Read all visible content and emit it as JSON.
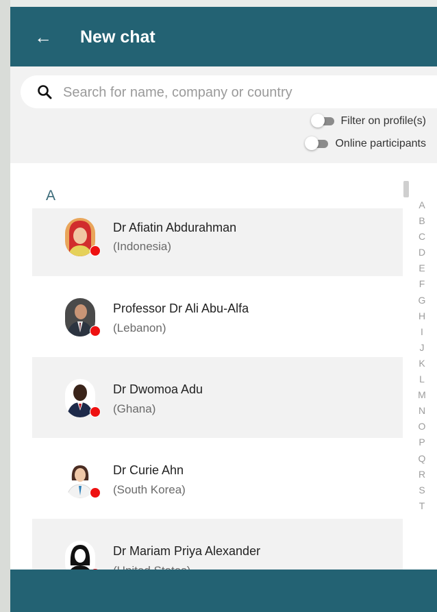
{
  "header": {
    "title": "New chat",
    "back_icon": "arrow-left-icon"
  },
  "search": {
    "placeholder": "Search for name, company or country",
    "value": "",
    "icon": "search-icon"
  },
  "filters": [
    {
      "label": "Filter on profile(s)",
      "on": false
    },
    {
      "label": "Online participants",
      "on": false
    }
  ],
  "list": {
    "section_letter": "A",
    "participants": [
      {
        "name": "Dr Afiatin Abdurahman",
        "country": "(Indonesia)",
        "status_color": "#ee1111"
      },
      {
        "name": "Professor Dr Ali Abu-Alfa",
        "country": "(Lebanon)",
        "status_color": "#ee1111"
      },
      {
        "name": "Dr Dwomoa Adu",
        "country": "(Ghana)",
        "status_color": "#ee1111"
      },
      {
        "name": "Dr Curie Ahn",
        "country": "(South Korea)",
        "status_color": "#ee1111"
      },
      {
        "name": "Dr Mariam Priya Alexander",
        "country": "(United States)",
        "status_color": "#ee1111"
      }
    ]
  },
  "alphabet": [
    "A",
    "B",
    "C",
    "D",
    "E",
    "F",
    "G",
    "H",
    "I",
    "J",
    "K",
    "L",
    "M",
    "N",
    "O",
    "P",
    "Q",
    "R",
    "S",
    "T"
  ],
  "colors": {
    "header": "#236273",
    "status_offline": "#ee1111",
    "section_letter": "#3a6a78"
  }
}
